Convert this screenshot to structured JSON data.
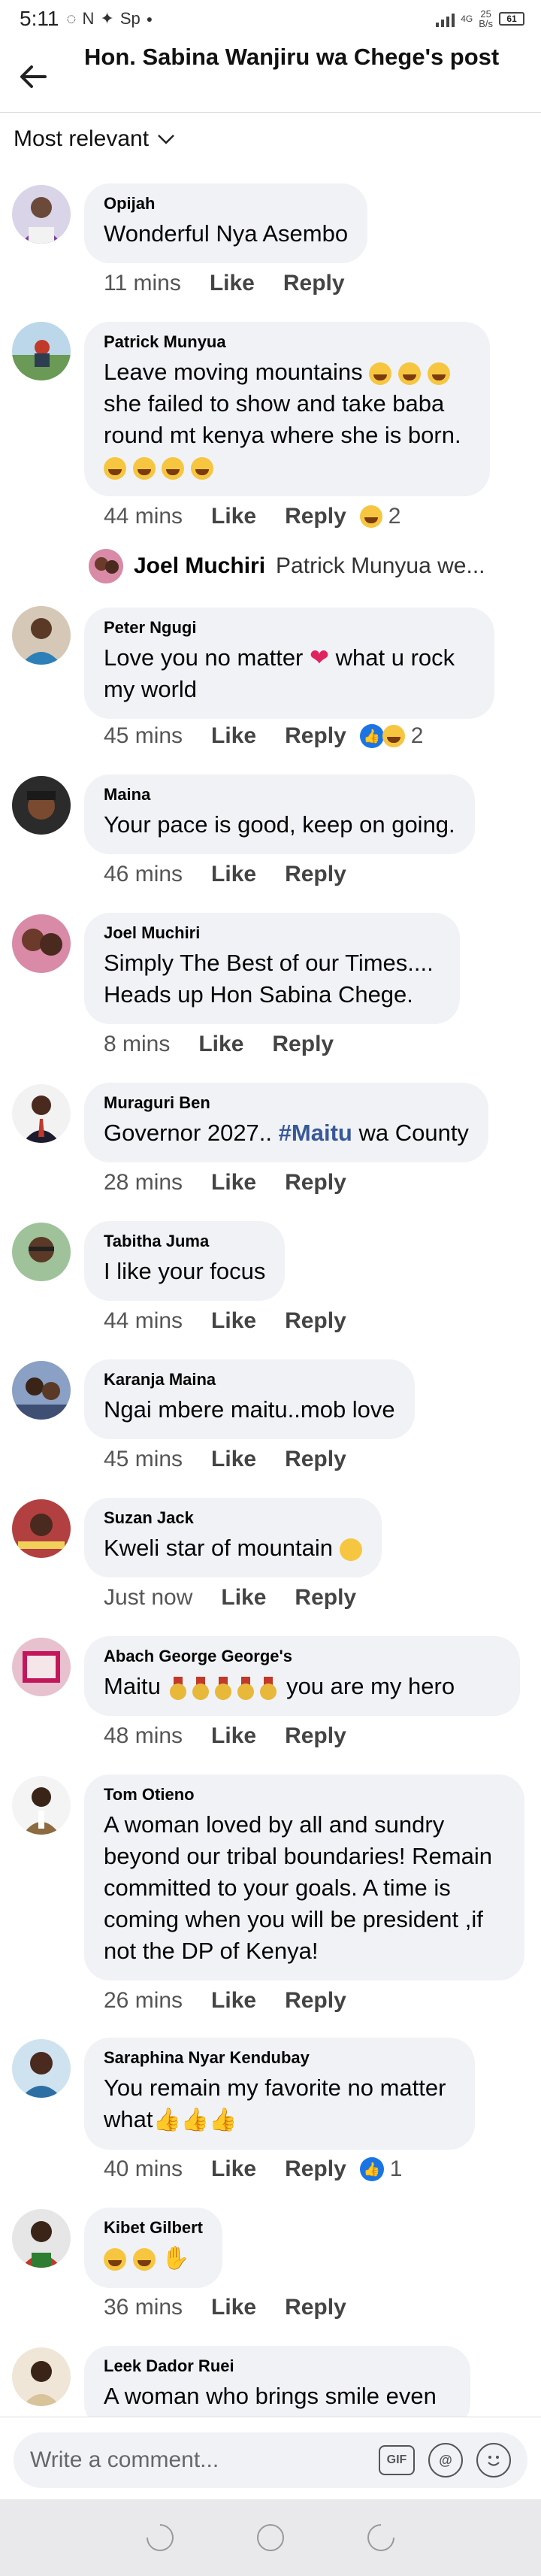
{
  "status_bar": {
    "time": "5:11",
    "speed_value": "25",
    "speed_unit": "B/s",
    "network": "4G",
    "battery": "61"
  },
  "header": {
    "title": "Hon. Sabina Wanjiru wa Chege's post"
  },
  "sort": {
    "label": "Most relevant"
  },
  "actions": {
    "like": "Like",
    "reply": "Reply"
  },
  "comments": [
    {
      "name": "Opijah",
      "text": "Wonderful Nya Asembo",
      "time": "11 mins"
    },
    {
      "name": "Patrick Munyua",
      "text": "Leave moving mountains",
      "text2": "she failed to show and take  baba round mt kenya where she is born.",
      "time": "44 mins",
      "reactions": "2"
    },
    {
      "name": "Peter Ngugi",
      "text_a": "Love you no matter",
      "text_b": "what u rock my world",
      "time": "45 mins",
      "reactions": "2"
    },
    {
      "name": "Maina",
      "text": "Your pace is good, keep on going.",
      "time": "46 mins"
    },
    {
      "name": "Joel Muchiri",
      "text": "Simply The Best of our Times.... Heads up Hon Sabina Chege.",
      "time": "8 mins"
    },
    {
      "name": "Muraguri Ben",
      "text_a": "Governor 2027..",
      "hashtag": "#Maitu",
      "text_b": "wa County",
      "time": "28 mins"
    },
    {
      "name": "Tabitha Juma",
      "text": "I like your focus",
      "time": "44 mins"
    },
    {
      "name": "Karanja Maina",
      "text": "Ngai mbere maitu..mob love",
      "time": "45 mins"
    },
    {
      "name": "Suzan Jack",
      "text": "Kweli star of mountain",
      "time": "Just now"
    },
    {
      "name": "Abach George George's",
      "text_a": "Maitu",
      "text_b": "you are my hero",
      "time": "48 mins"
    },
    {
      "name": "Tom Otieno",
      "text": "A woman loved by all and sundry beyond our tribal boundaries! Remain committed to your goals. A time is coming when you will be president ,if not the DP of Kenya!",
      "time": "26 mins"
    },
    {
      "name": "Saraphina Nyar Kendubay",
      "text": "You remain my favorite no matter what",
      "time": "40 mins",
      "reactions": "1"
    },
    {
      "name": "Kibet Gilbert",
      "time": "36 mins"
    },
    {
      "name": "Leek Dador Ruei",
      "text": "A woman who brings smile even"
    }
  ],
  "reply_preview": {
    "name": "Joel Muchiri",
    "text": "Patrick Munyua we..."
  },
  "composer": {
    "placeholder": "Write a comment...",
    "gif": "GIF",
    "at": "@"
  },
  "colors": {
    "bubble": "#f0f2f5",
    "link": "#385898",
    "like_blue": "#1b74e4"
  }
}
